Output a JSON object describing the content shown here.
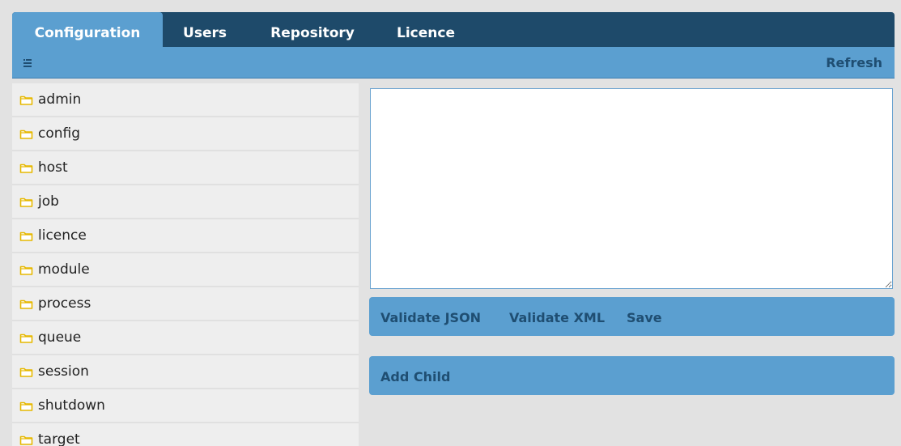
{
  "tabs": [
    {
      "label": "Configuration",
      "active": true
    },
    {
      "label": "Users",
      "active": false
    },
    {
      "label": "Repository",
      "active": false
    },
    {
      "label": "Licence",
      "active": false
    }
  ],
  "toolbar": {
    "menu_icon": "list-icon",
    "refresh_label": "Refresh"
  },
  "tree": {
    "folder_icon": "folder-icon",
    "items": [
      "admin",
      "config",
      "host",
      "job",
      "licence",
      "module",
      "process",
      "queue",
      "session",
      "shutdown",
      "target"
    ]
  },
  "editor": {
    "value": ""
  },
  "actions": {
    "validate_json": "Validate JSON",
    "validate_xml": "Validate XML",
    "save": "Save",
    "add_child": "Add Child"
  },
  "colors": {
    "tabbar": "#1e4a6a",
    "accent": "#5b9fd0",
    "accent_text": "#1f4e72",
    "folder": "#e6b800"
  }
}
